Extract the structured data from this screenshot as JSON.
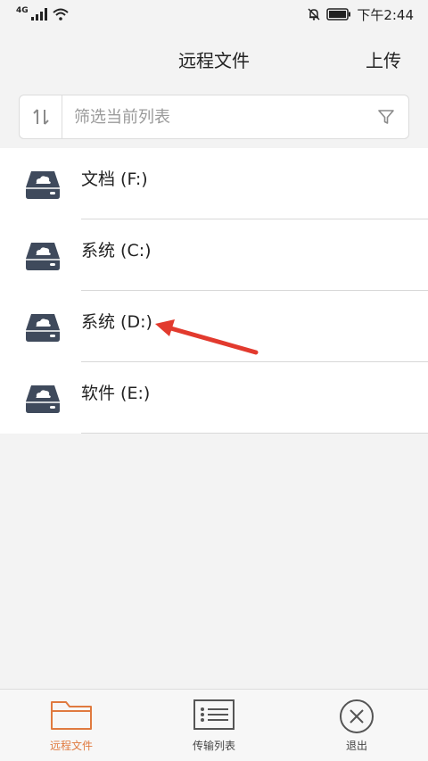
{
  "status_bar": {
    "network": "4G",
    "time": "下午2:44"
  },
  "header": {
    "title": "远程文件",
    "upload_label": "上传"
  },
  "filter": {
    "placeholder": "筛选当前列表"
  },
  "drives": [
    {
      "label": "文档 (F:)"
    },
    {
      "label": "系统 (C:)"
    },
    {
      "label": "系统 (D:)"
    },
    {
      "label": "软件 (E:)"
    }
  ],
  "tabs": [
    {
      "label": "远程文件",
      "icon": "folder-icon",
      "active": true
    },
    {
      "label": "传输列表",
      "icon": "list-icon",
      "active": false
    },
    {
      "label": "退出",
      "icon": "close-circle-icon",
      "active": false
    }
  ],
  "colors": {
    "accent": "#e07a3f",
    "drive_icon": "#3f4a5c",
    "annotation": "#e23a2e"
  }
}
